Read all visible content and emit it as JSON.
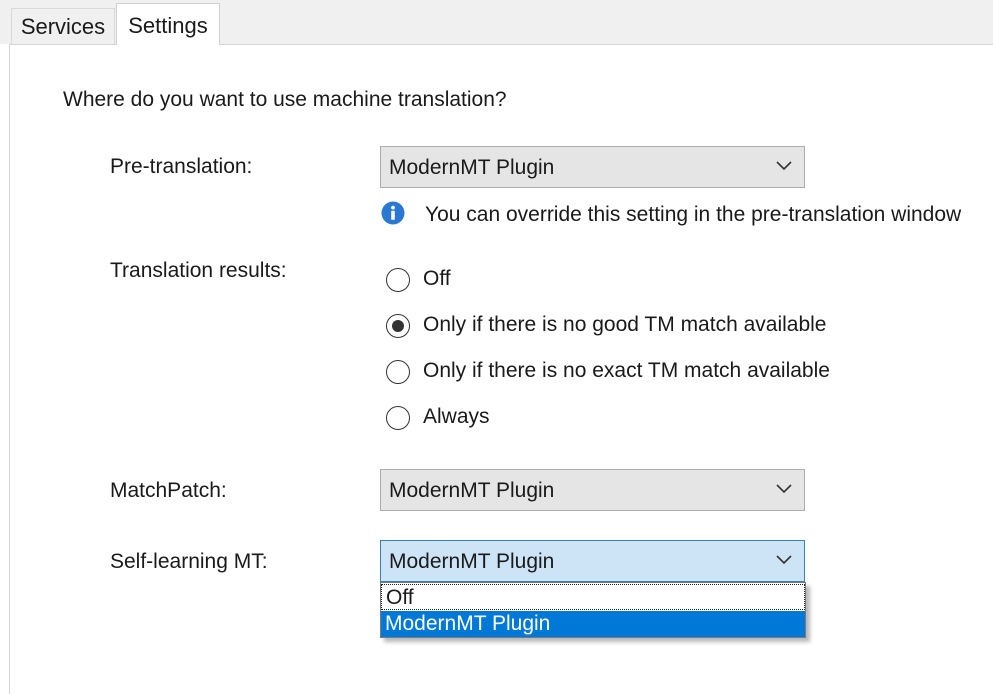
{
  "tabs": [
    {
      "label": "Services"
    },
    {
      "label": "Settings"
    }
  ],
  "settings": {
    "question": "Where do you want to use machine translation?",
    "pretranslation": {
      "label": "Pre-translation:",
      "value": "ModernMT Plugin",
      "hint": "You can override this setting in the pre-translation window",
      "hint_icon": "info-icon"
    },
    "translation_results": {
      "label": "Translation results:",
      "options": [
        {
          "label": "Off",
          "selected": false
        },
        {
          "label": "Only if there is no good TM match available",
          "selected": true
        },
        {
          "label": "Only if there is no exact TM match available",
          "selected": false
        },
        {
          "label": "Always",
          "selected": false
        }
      ]
    },
    "matchpatch": {
      "label": "MatchPatch:",
      "value": "ModernMT Plugin"
    },
    "self_learning": {
      "label": "Self-learning MT:",
      "value": "ModernMT Plugin",
      "dropdown_options": [
        "Off",
        "ModernMT Plugin"
      ],
      "highlighted_option": "ModernMT Plugin"
    }
  },
  "colors": {
    "accent": "#0078d7",
    "info_icon": "#2b78d4",
    "combo_bg": "#e5e5e5",
    "combo_open_bg": "#cde4f7"
  }
}
